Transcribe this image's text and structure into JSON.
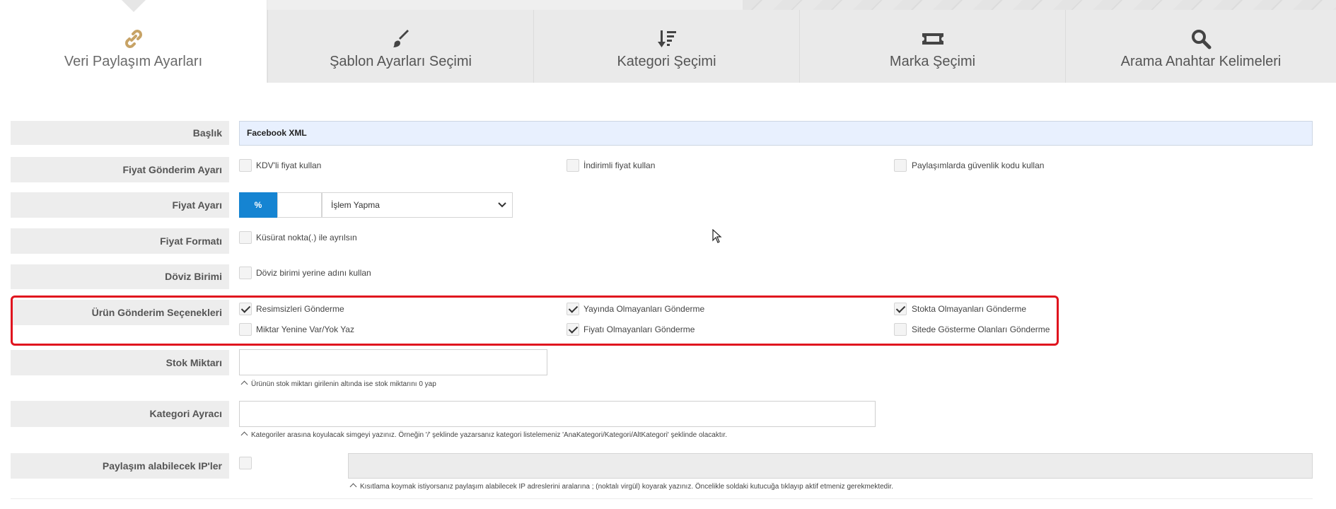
{
  "tabs": [
    {
      "label": "Veri Paylaşım Ayarları",
      "icon": "link-icon",
      "active": true
    },
    {
      "label": "Şablon Ayarları Seçimi",
      "icon": "brush-icon"
    },
    {
      "label": "Kategori Şeçimi",
      "icon": "sort-icon"
    },
    {
      "label": "Marka Şeçimi",
      "icon": "ticket-icon"
    },
    {
      "label": "Arama Anahtar Kelimeleri",
      "icon": "search-icon"
    }
  ],
  "form": {
    "baslik": {
      "label": "Başlık",
      "value": "Facebook XML"
    },
    "fiyat_gonderim": {
      "label": "Fiyat Gönderim Ayarı",
      "options": [
        {
          "text": "KDV'li fiyat kullan",
          "checked": false
        },
        {
          "text": "İndirimli fiyat kullan",
          "checked": false
        },
        {
          "text": "Paylaşımlarda güvenlik kodu kullan",
          "checked": false
        }
      ]
    },
    "fiyat_ayari": {
      "label": "Fiyat Ayarı",
      "percent": "%",
      "amount": "",
      "select": "İşlem Yapma"
    },
    "fiyat_formati": {
      "label": "Fiyat Formatı",
      "option": {
        "text": "Küsürat nokta(.) ile ayrılsın",
        "checked": false
      }
    },
    "doviz_birimi": {
      "label": "Döviz Birimi",
      "option": {
        "text": "Döviz birimi yerine adını kullan",
        "checked": false
      }
    },
    "urun_gonderim": {
      "label": "Ürün Gönderim Seçenekleri",
      "options": [
        {
          "text": "Resimsizleri Gönderme",
          "checked": true
        },
        {
          "text": "Yayında Olmayanları Gönderme",
          "checked": true
        },
        {
          "text": "Stokta Olmayanları Gönderme",
          "checked": true
        },
        {
          "text": "Miktar Yenine Var/Yok Yaz",
          "checked": false
        },
        {
          "text": "Fiyatı Olmayanları Gönderme",
          "checked": true
        },
        {
          "text": "Sitede Gösterme Olanları Gönderme",
          "checked": false
        }
      ]
    },
    "stok_miktari": {
      "label": "Stok Miktarı",
      "value": "",
      "hint": "Ürünün stok miktarı girilenin altında ise stok miktarını 0 yap"
    },
    "kategori_ayraci": {
      "label": "Kategori Ayracı",
      "value": "",
      "hint": "Kategoriler arasına koyulacak simgeyi yazınız. Örneğin '/' şeklinde yazarsanız kategori listelemeniz 'AnaKategori/Kategori/AltKategori' şeklinde olacaktır."
    },
    "ip": {
      "label": "Paylaşım alabilecek IP'ler",
      "checked": false,
      "value": "",
      "hint": "Kısıtlama koymak istiyorsanız paylaşım alabilecek IP adreslerini aralarına ; (noktalı virgül) koyarak yazınız. Öncelikle soldaki kutucuğa tıklayıp aktif etmeniz gerekmektedir."
    }
  },
  "colors": {
    "accent": "#1584d2",
    "highlight": "#e0141e",
    "active_icon": "#c7a366"
  }
}
